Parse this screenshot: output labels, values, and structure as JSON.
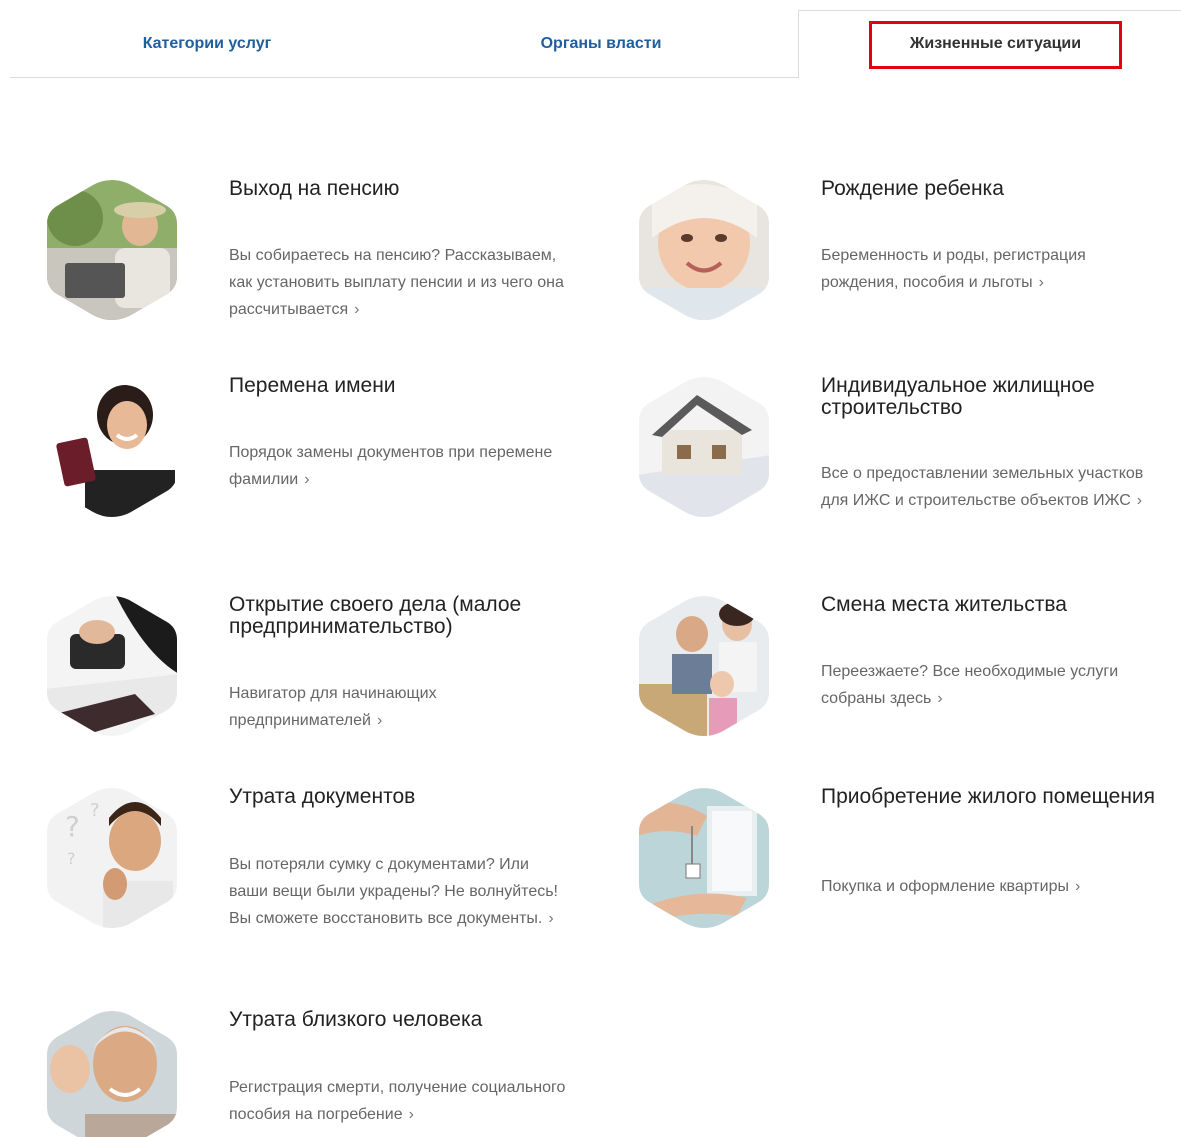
{
  "tabs": [
    {
      "label": "Категории услуг",
      "active": false
    },
    {
      "label": "Органы власти",
      "active": false
    },
    {
      "label": "Жизненные ситуации",
      "active": true
    }
  ],
  "chevron": "›",
  "situations": [
    {
      "title": "Выход на пенсию",
      "description": "Вы собираетесь на пенсию? Рассказываем, как установить выплату пенсии и из чего она рассчитывается"
    },
    {
      "title": "Рождение ребенка",
      "description": "Беременность и роды, регистрация рождения, пособия и льготы"
    },
    {
      "title": "Перемена имени",
      "description": "Порядок замены документов при перемене фамилии"
    },
    {
      "title": "Индивидуальное жилищное строительство",
      "description": "Все о предоставлении земельных участков для ИЖС и строительстве объектов ИЖС"
    },
    {
      "title": "Открытие своего дела (малое предпринимательство)",
      "description": "Навигатор для начинающих предпринимателей"
    },
    {
      "title": "Смена места жительства",
      "description": "Переезжаете? Все необходимые услуги собраны здесь"
    },
    {
      "title": "Утрата документов",
      "description": "Вы потеряли сумку с документами? Или ваши вещи были украдены? Не волнуйтесь! Вы сможете восстановить все документы."
    },
    {
      "title": "Приобретение жилого помещения",
      "description": "Покупка и оформление квартиры"
    },
    {
      "title": "Утрата близкого человека",
      "description": "Регистрация смерти, получение социального пособия на погребение"
    }
  ],
  "colors": {
    "tab_link": "#1f5e9f",
    "highlight": "#e3000f",
    "desc_text": "#666666"
  }
}
